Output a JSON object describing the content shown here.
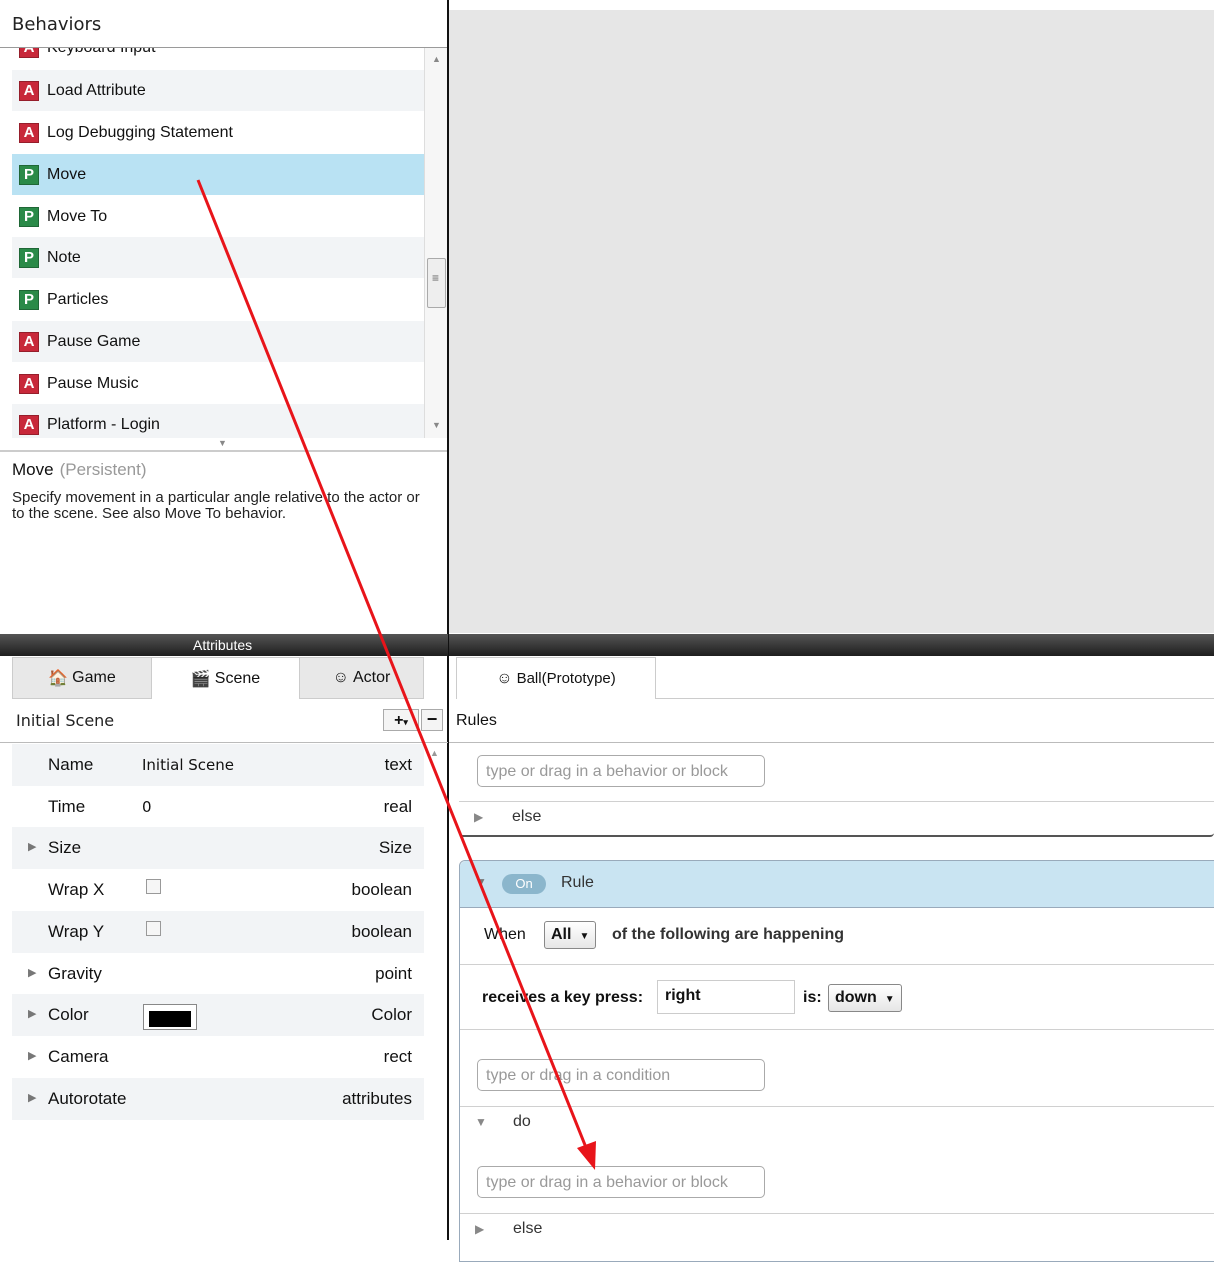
{
  "behaviors_panel": {
    "title": "Behaviors",
    "items": [
      {
        "badge": "A",
        "label": "Keyboard Input"
      },
      {
        "badge": "A",
        "label": "Load Attribute"
      },
      {
        "badge": "A",
        "label": "Log Debugging Statement"
      },
      {
        "badge": "P",
        "label": "Move",
        "selected": true
      },
      {
        "badge": "P",
        "label": "Move To"
      },
      {
        "badge": "P",
        "label": "Note"
      },
      {
        "badge": "P",
        "label": "Particles"
      },
      {
        "badge": "A",
        "label": "Pause Game"
      },
      {
        "badge": "A",
        "label": "Pause Music"
      },
      {
        "badge": "A",
        "label": "Platform - Login"
      }
    ],
    "description": {
      "name": "Move",
      "kind": "(Persistent)",
      "text": "Specify movement in a particular angle relative to the actor or to the scene. See also Move To behavior."
    }
  },
  "attributes_panel": {
    "bar_title": "Attributes",
    "tabs": {
      "game": "Game",
      "scene": "Scene",
      "actor": "Actor",
      "active": "Scene"
    },
    "scene_title": "Initial Scene",
    "add_button": "+",
    "remove_button": "−",
    "rows": [
      {
        "name": "Name",
        "value": "Initial Scene",
        "type": "text",
        "expandable": false
      },
      {
        "name": "Time",
        "value": "0",
        "type": "real",
        "expandable": false
      },
      {
        "name": "Size",
        "value": "",
        "type": "Size",
        "expandable": true
      },
      {
        "name": "Wrap X",
        "value": "",
        "type": "boolean",
        "expandable": false,
        "checkbox": true
      },
      {
        "name": "Wrap Y",
        "value": "",
        "type": "boolean",
        "expandable": false,
        "checkbox": true
      },
      {
        "name": "Gravity",
        "value": "",
        "type": "point",
        "expandable": true
      },
      {
        "name": "Color",
        "value": "",
        "type": "Color",
        "expandable": true,
        "color": "#000000"
      },
      {
        "name": "Camera",
        "value": "",
        "type": "rect",
        "expandable": true
      },
      {
        "name": "Autorotate",
        "value": "",
        "type": "attributes",
        "expandable": true
      }
    ]
  },
  "editor": {
    "tab": "Ball(Prototype)",
    "rules_label": "Rules",
    "behavior_placeholder": "type or drag in a behavior or block",
    "condition_placeholder": "type or drag in a condition",
    "else_label": "else",
    "do_label": "do",
    "rule": {
      "toggle": "On",
      "title": "Rule",
      "when_label": "When",
      "when_select": "All",
      "when_suffix": "of the following are happening",
      "condition_label": "receives a key press:",
      "key_value": "right",
      "is_label": "is:",
      "is_select": "down"
    }
  },
  "colors": {
    "accent_arrow": "#e8141a",
    "selected_row": "#b9e2f3",
    "rule_header": "#c9e4f2",
    "badge_action": "#c8283a",
    "badge_persistent": "#2a8a48"
  }
}
